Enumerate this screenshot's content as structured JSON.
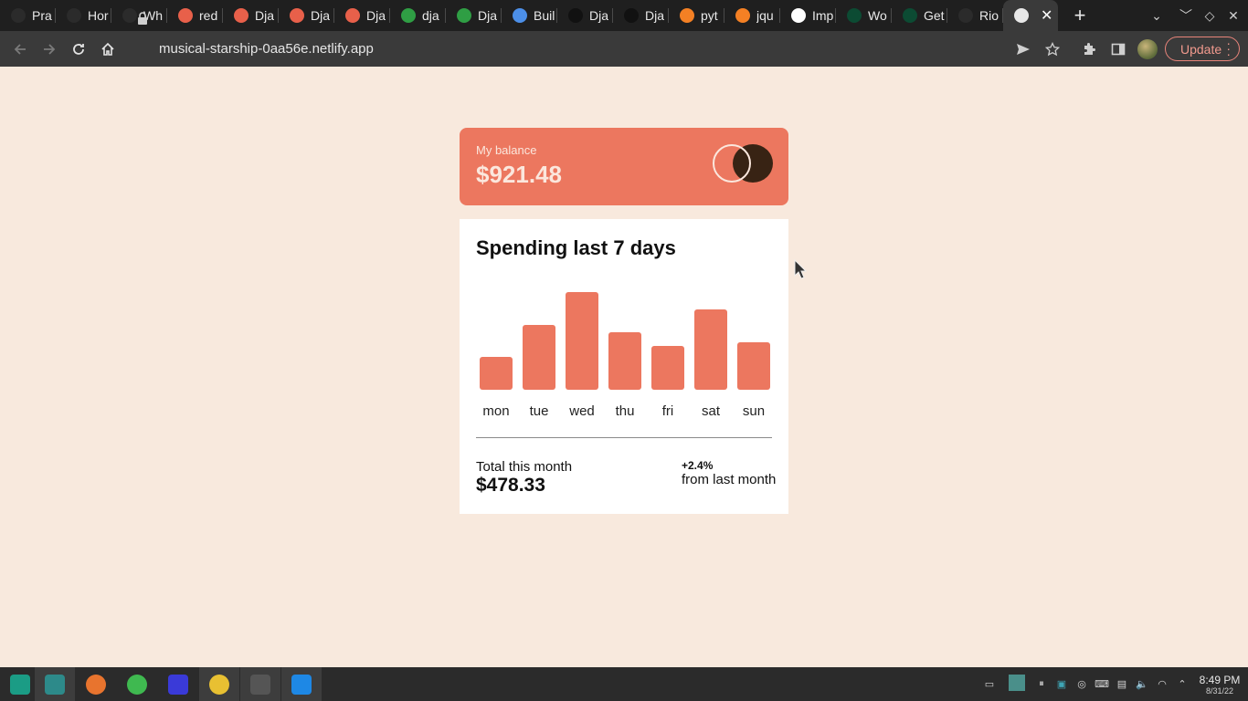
{
  "browser": {
    "tabs": [
      {
        "label": "Pra",
        "icon": "github-icon",
        "color": "#2b2b2b"
      },
      {
        "label": "Hor",
        "icon": "github-icon",
        "color": "#2b2b2b"
      },
      {
        "label": "Wh",
        "icon": "github-icon",
        "color": "#2b2b2b"
      },
      {
        "label": "red",
        "icon": "flame-icon",
        "color": "#e8604a"
      },
      {
        "label": "Dja",
        "icon": "folder-icon",
        "color": "#e8604a"
      },
      {
        "label": "Dja",
        "icon": "folder-icon",
        "color": "#e8604a"
      },
      {
        "label": "Dja",
        "icon": "folder-icon",
        "color": "#e8604a"
      },
      {
        "label": "dja",
        "icon": "code-icon",
        "color": "#2f9e44"
      },
      {
        "label": "Dja",
        "icon": "link-icon",
        "color": "#2f9e44"
      },
      {
        "label": "Buil",
        "icon": "puzzle-icon",
        "color": "#4c8fe8"
      },
      {
        "label": "Dja",
        "icon": "medium-icon",
        "color": "#111111"
      },
      {
        "label": "Dja",
        "icon": "medium-icon",
        "color": "#111111"
      },
      {
        "label": "pyt",
        "icon": "stackoverflow-icon",
        "color": "#f48024"
      },
      {
        "label": "jqu",
        "icon": "stackoverflow-icon",
        "color": "#f48024"
      },
      {
        "label": "Imp",
        "icon": "google-icon",
        "color": "#ffffff"
      },
      {
        "label": "Wo",
        "icon": "django-icon",
        "color": "#0c4b33"
      },
      {
        "label": "Get",
        "icon": "django-icon",
        "color": "#0c4b33"
      },
      {
        "label": "Rio",
        "icon": "github-icon",
        "color": "#2b2b2b"
      }
    ],
    "url": "musical-starship-0aa56e.netlify.app",
    "update_label": "Update"
  },
  "balance": {
    "label": "My balance",
    "value": "$921.48"
  },
  "spending": {
    "title": "Spending last 7 days",
    "total_label": "Total this month",
    "total_value": "$478.33",
    "change_value": "+2.4%",
    "change_label": "from last month"
  },
  "chart_data": {
    "type": "bar",
    "categories": [
      "mon",
      "tue",
      "wed",
      "thu",
      "fri",
      "sat",
      "sun"
    ],
    "values": [
      17.45,
      34.91,
      52.36,
      31.07,
      23.39,
      43.28,
      25.48
    ],
    "bar_color": "#ec775f"
  },
  "taskbar": {
    "apps": [
      "manjaro-icon",
      "files-icon",
      "firefox-icon",
      "downloader-icon",
      "intellij-icon",
      "chrome-icon",
      "terminal-icon",
      "vscode-icon"
    ],
    "time": "8:49 PM",
    "date": "8/31/22"
  }
}
